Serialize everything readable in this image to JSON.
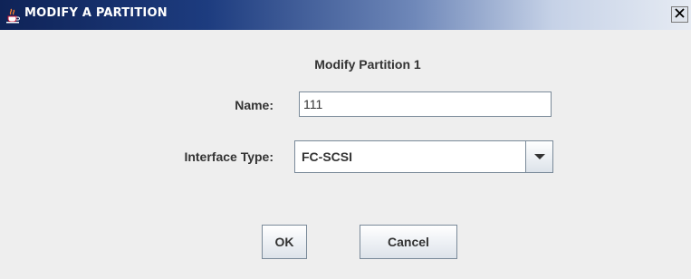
{
  "window": {
    "title": "MODIFY A PARTITION",
    "close_glyph": "✕",
    "icon": "java-cup-icon"
  },
  "dialog": {
    "header": "Modify Partition 1",
    "name_label": "Name:",
    "name_value": "111",
    "interface_label": "Interface Type:",
    "interface_value": "FC-SCSI",
    "ok_label": "OK",
    "cancel_label": "Cancel"
  },
  "colors": {
    "titlebar_start": "#0f2357",
    "titlebar_end": "#e6ebf3",
    "background": "#eeeeee"
  }
}
